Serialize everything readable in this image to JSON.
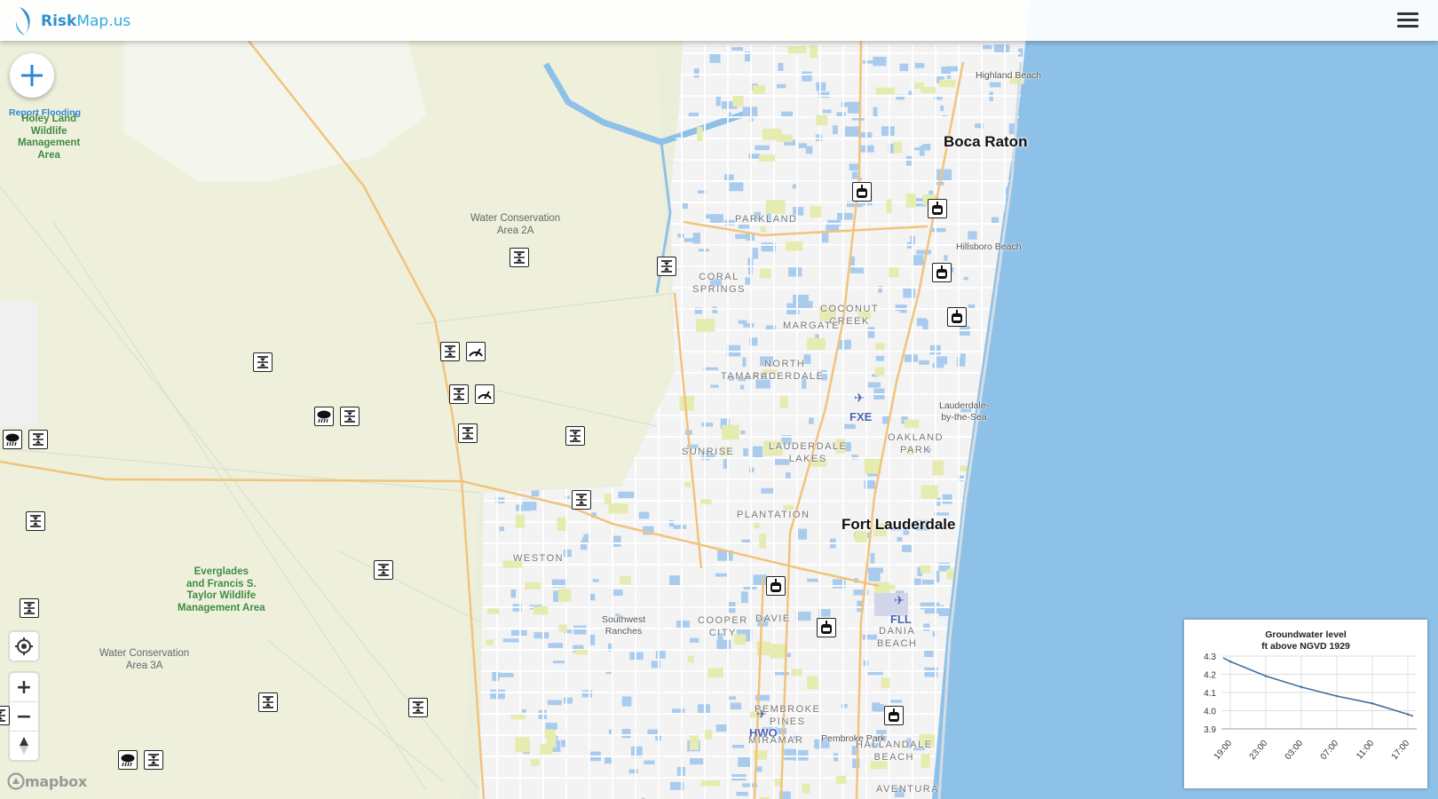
{
  "header": {
    "logo_text_bold": "Risk",
    "logo_text_rest": "Map.us",
    "menu_icon": "hamburger-menu-icon"
  },
  "report_button": {
    "label": "Report Flooding",
    "icon": "plus-icon"
  },
  "map_controls": {
    "locate_icon": "crosshair-target-icon",
    "zoom_in": "+",
    "zoom_out": "−",
    "compass_icon": "compass-north-icon"
  },
  "attribution": {
    "text": "mapbox",
    "icon": "mapbox-logo-icon"
  },
  "map": {
    "places": {
      "area_top_left": "Holey Land\nWildlife\nManagement\nArea",
      "area_top_left_partial": "Management",
      "wca2a": "Water Conservation\nArea 2A",
      "everglades": "Everglades\nand Francis S.\nTaylor Wildlife\nManagement Area",
      "wca3a": "Water Conservation\nArea 3A",
      "highland_beach": "Highland Beach",
      "boca_raton": "Boca Raton",
      "parkland": "PARKLAND",
      "hillsboro_beach": "Hillsboro Beach",
      "coral_springs": "CORAL\nSPRINGS",
      "coconut_creek": "COCONUT\nCREEK",
      "margate": "MARGATE",
      "north_lauderdale": "NORTH\nLAUDERDALE",
      "tamarac": "TAMARAC",
      "fxe": "FXE",
      "lauderdale_by_the_sea": "Lauderdale-\nby-the-Sea",
      "oakland_park": "OAKLAND\nPARK",
      "sunrise": "SUNRISE",
      "lauderdale_lakes": "LAUDERDALE\nLAKES",
      "plantation": "PLANTATION",
      "fort_lauderdale": "Fort Lauderdale",
      "weston": "WESTON",
      "fll": "FLL",
      "southwest_ranches": "Southwest\nRanches",
      "cooper_city": "COOPER\nCITY",
      "davie": "DAVIE",
      "dania_beach": "DANIA\nBEACH",
      "pembroke_pines": "PEMBROKE\nPINES",
      "hwo": "HWO",
      "miramar": "MIRAMAR",
      "pembroke_park": "Pembroke Park",
      "hallandale_beach": "HALLANDALE\nBEACH",
      "aventura": "AVENTURA"
    },
    "marker_types": {
      "gate": "flood-gate-icon",
      "pump": "pump-station-icon",
      "rain": "rain-cloud-icon",
      "gauge": "gauge-icon"
    }
  },
  "chart_data": {
    "type": "line",
    "title": "Groundwater level\nft above NGVD 1929",
    "x": [
      "19:00",
      "23:00",
      "03:00",
      "07:00",
      "11:00",
      "17:00"
    ],
    "series": [
      {
        "values": [
          4.27,
          4.19,
          4.13,
          4.08,
          4.04,
          3.98
        ]
      }
    ],
    "ylim": [
      3.9,
      4.3
    ],
    "yticks": [
      "4.3",
      "4.2",
      "4.1",
      "4.0",
      "3.9"
    ],
    "grid": true
  }
}
